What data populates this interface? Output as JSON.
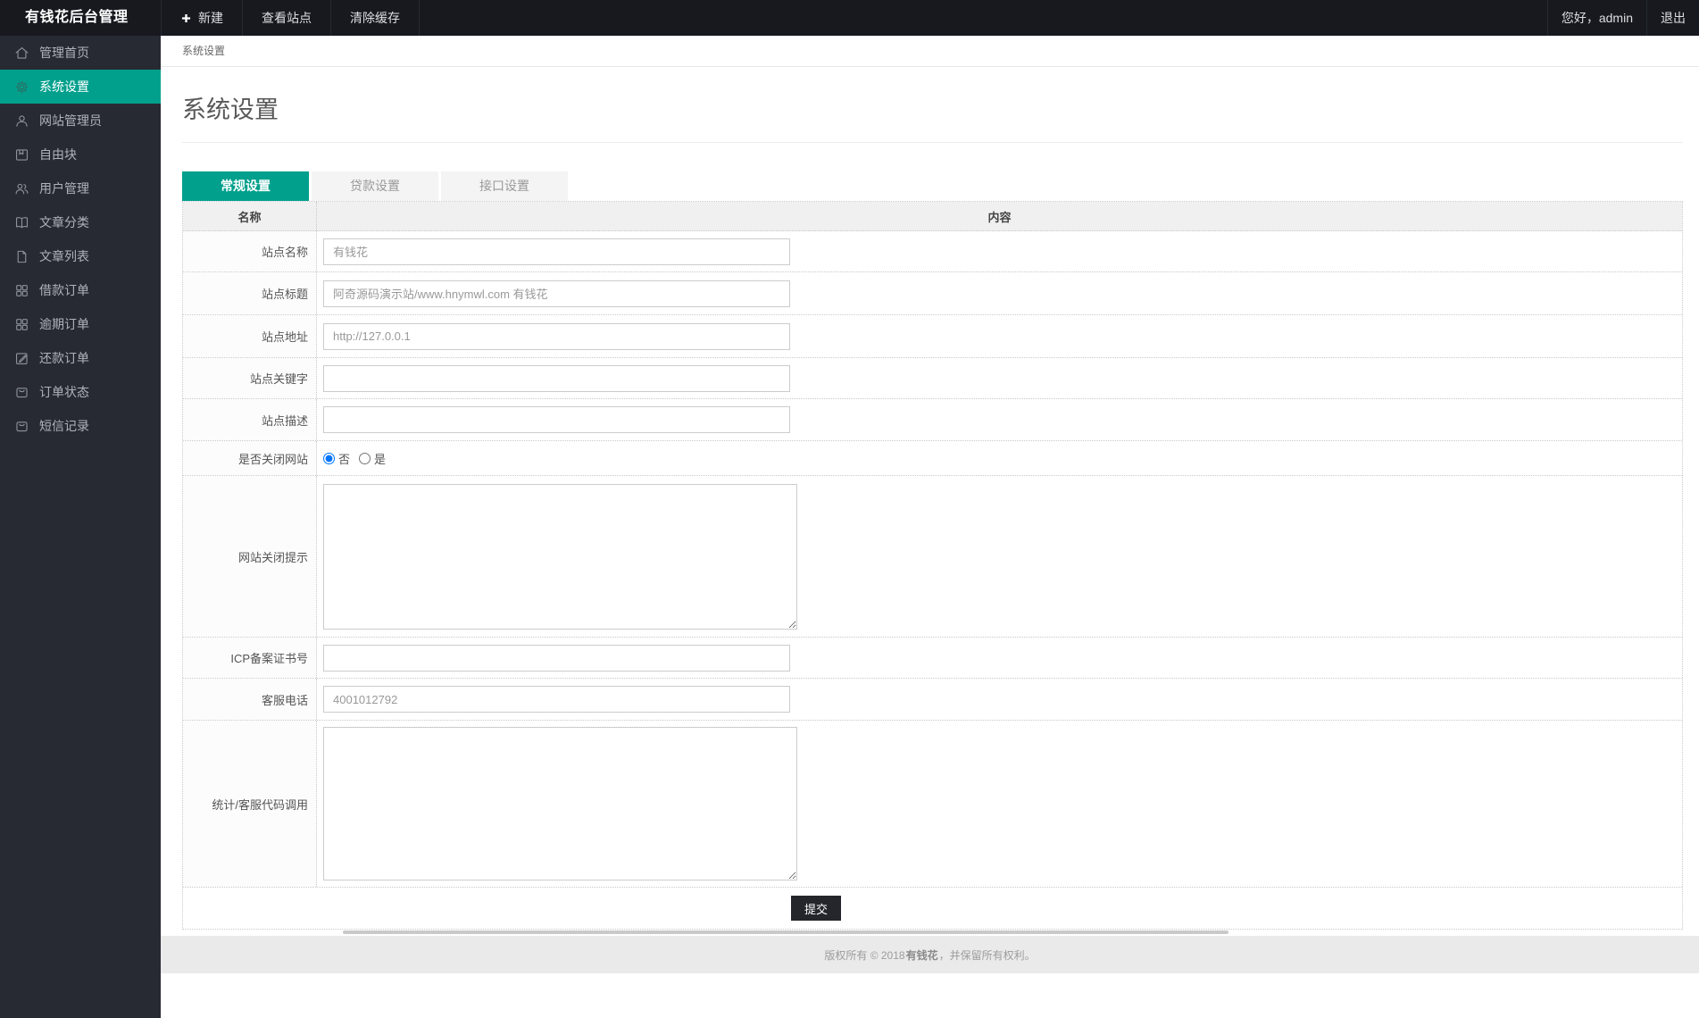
{
  "topbar": {
    "brand": "有钱花后台管理",
    "menu": [
      {
        "label": "新建",
        "icon": "plus-icon"
      },
      {
        "label": "查看站点"
      },
      {
        "label": "清除缓存"
      }
    ],
    "greeting": "您好，admin",
    "logout_label": "退出"
  },
  "sidebar": {
    "items": [
      {
        "label": "管理首页",
        "icon": "home-icon",
        "active": false
      },
      {
        "label": "系统设置",
        "icon": "gear-icon",
        "active": true
      },
      {
        "label": "网站管理员",
        "icon": "user-icon",
        "active": false
      },
      {
        "label": "自由块",
        "icon": "block-icon",
        "active": false
      },
      {
        "label": "用户管理",
        "icon": "users-icon",
        "active": false
      },
      {
        "label": "文章分类",
        "icon": "book-icon",
        "active": false
      },
      {
        "label": "文章列表",
        "icon": "file-icon",
        "active": false
      },
      {
        "label": "借款订单",
        "icon": "grid-icon",
        "active": false
      },
      {
        "label": "逾期订单",
        "icon": "grid-icon",
        "active": false
      },
      {
        "label": "还款订单",
        "icon": "edit-icon",
        "active": false
      },
      {
        "label": "订单状态",
        "icon": "bag-icon",
        "active": false
      },
      {
        "label": "短信记录",
        "icon": "message-icon",
        "active": false
      }
    ]
  },
  "breadcrumb": "系统设置",
  "page": {
    "title": "系统设置"
  },
  "tabs": [
    {
      "label": "常规设置",
      "active": true
    },
    {
      "label": "贷款设置",
      "active": false
    },
    {
      "label": "接口设置",
      "active": false
    }
  ],
  "form": {
    "header": {
      "name_col": "名称",
      "content_col": "内容"
    },
    "rows": [
      {
        "label": "站点名称",
        "type": "input",
        "value": "有钱花"
      },
      {
        "label": "站点标题",
        "type": "input",
        "value": "阿奇源码演示站/www.hnymwl.com 有钱花"
      },
      {
        "label": "站点地址",
        "type": "input",
        "value": "http://127.0.0.1"
      },
      {
        "label": "站点关键字",
        "type": "input",
        "value": ""
      },
      {
        "label": "站点描述",
        "type": "input",
        "value": ""
      },
      {
        "label": "是否关闭网站",
        "type": "radio",
        "options": [
          "否",
          "是"
        ],
        "selected": "否"
      },
      {
        "label": "网站关闭提示",
        "type": "textarea",
        "value": ""
      },
      {
        "label": "ICP备案证书号",
        "type": "input",
        "value": ""
      },
      {
        "label": "客服电话",
        "type": "input",
        "value": "4001012792"
      },
      {
        "label": "统计/客服代码调用",
        "type": "textarea",
        "value": ""
      }
    ],
    "submit_label": "提交"
  },
  "footer": {
    "prefix": "版权所有 © 2018 ",
    "brand": "有钱花",
    "suffix": "，并保留所有权利。"
  },
  "colors": {
    "accent": "#00a08c",
    "topbar": "#17191f",
    "sidebar": "#272a33"
  }
}
